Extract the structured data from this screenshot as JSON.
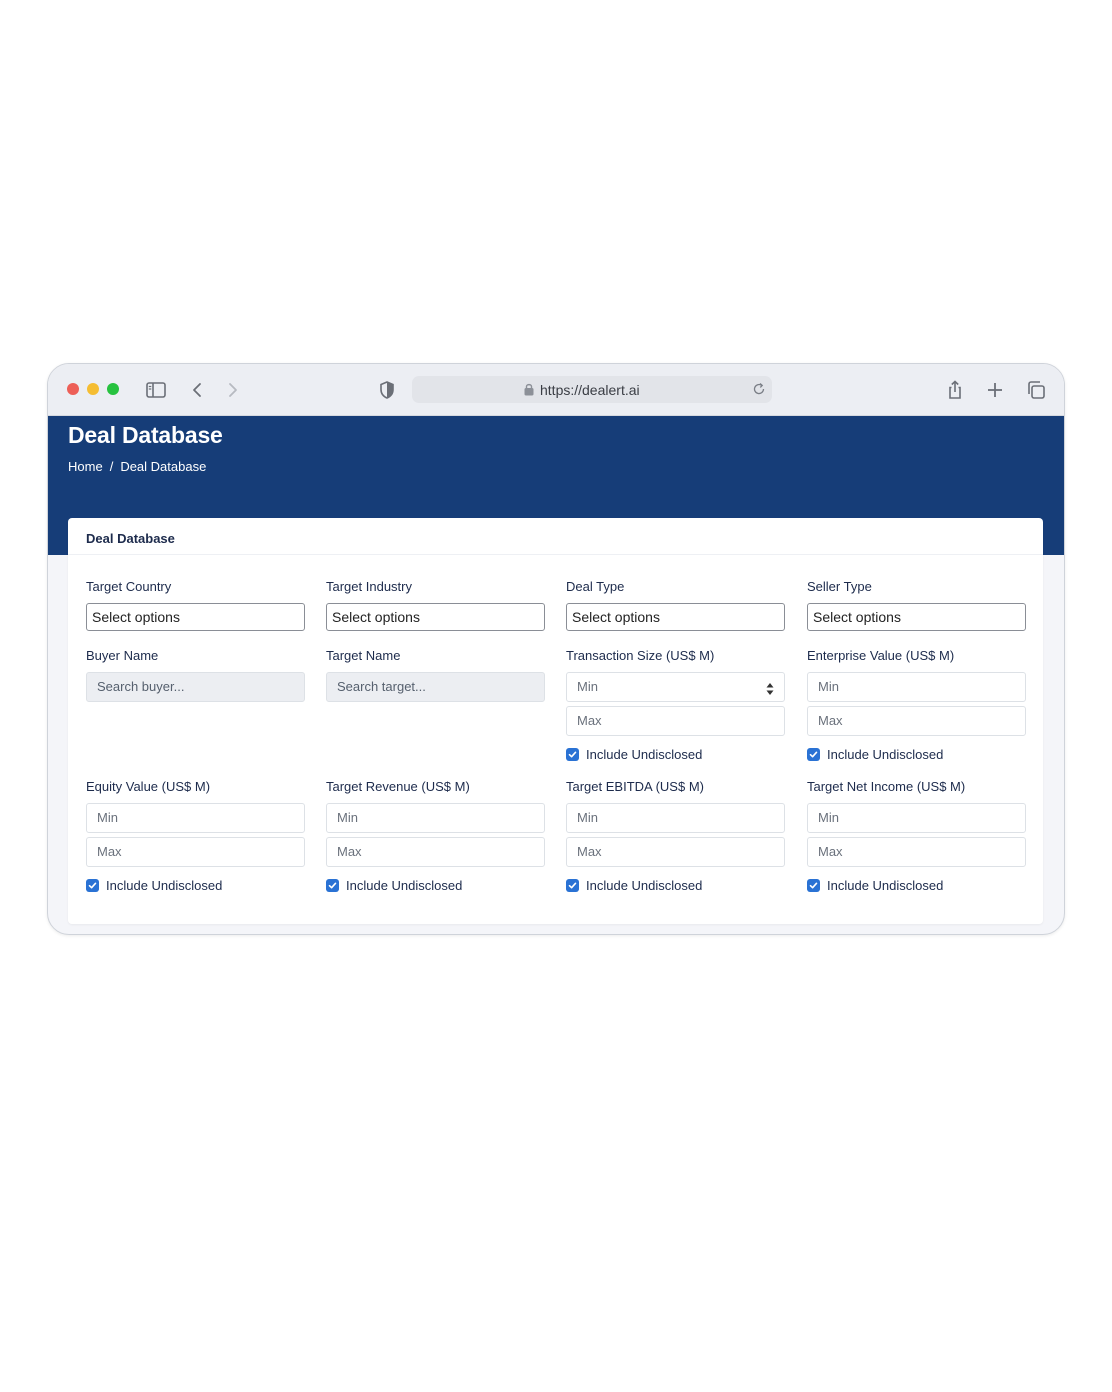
{
  "browser": {
    "url": "https://dealert.ai"
  },
  "header": {
    "title": "Deal Database",
    "breadcrumb": {
      "home": "Home",
      "separator": "/",
      "current": "Deal Database"
    }
  },
  "card": {
    "title": "Deal Database"
  },
  "filters": {
    "target_country": {
      "label": "Target Country",
      "value": "Select options"
    },
    "target_industry": {
      "label": "Target Industry",
      "value": "Select options"
    },
    "deal_type": {
      "label": "Deal Type",
      "value": "Select options"
    },
    "seller_type": {
      "label": "Seller Type",
      "value": "Select options"
    },
    "buyer_name": {
      "label": "Buyer Name",
      "placeholder": "Search buyer..."
    },
    "target_name": {
      "label": "Target Name",
      "placeholder": "Search target..."
    },
    "transaction_size": {
      "label": "Transaction Size (US$ M)",
      "min": "Min",
      "max": "Max",
      "include": "Include Undisclosed",
      "checked": true
    },
    "enterprise_value": {
      "label": "Enterprise Value (US$ M)",
      "min": "Min",
      "max": "Max",
      "include": "Include Undisclosed",
      "checked": true
    },
    "equity_value": {
      "label": "Equity Value (US$ M)",
      "min": "Min",
      "max": "Max",
      "include": "Include Undisclosed",
      "checked": true
    },
    "target_revenue": {
      "label": "Target Revenue (US$ M)",
      "min": "Min",
      "max": "Max",
      "include": "Include Undisclosed",
      "checked": true
    },
    "target_ebitda": {
      "label": "Target EBITDA (US$ M)",
      "min": "Min",
      "max": "Max",
      "include": "Include Undisclosed",
      "checked": true
    },
    "target_net_income": {
      "label": "Target Net Income (US$ M)",
      "min": "Min",
      "max": "Max",
      "include": "Include Undisclosed",
      "checked": true
    }
  },
  "colors": {
    "header_bg": "#163d78",
    "checkbox": "#2a72d4",
    "page_bg": "#f4f5f9"
  }
}
